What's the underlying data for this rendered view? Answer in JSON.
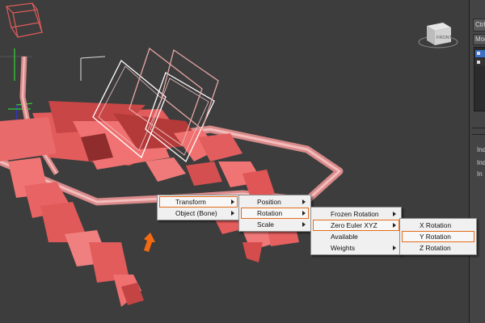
{
  "viewcube": {
    "label": "FRONT"
  },
  "command_panel": {
    "tab_label": "Ctrl",
    "modifier_label": "Mod",
    "rollout_items": [
      "Ind",
      "Ind",
      "In"
    ]
  },
  "menus": {
    "level1": [
      {
        "label": "Transform",
        "has_submenu": true,
        "highlighted": true
      },
      {
        "label": "Object (Bone)",
        "has_submenu": true,
        "highlighted": false
      }
    ],
    "level2": [
      {
        "label": "Position",
        "has_submenu": true,
        "highlighted": false
      },
      {
        "label": "Rotation",
        "has_submenu": true,
        "highlighted": true
      },
      {
        "label": "Scale",
        "has_submenu": true,
        "highlighted": false
      }
    ],
    "level3": [
      {
        "label": "Frozen Rotation",
        "has_submenu": true,
        "highlighted": false
      },
      {
        "label": "Zero Euler XYZ",
        "has_submenu": true,
        "highlighted": true
      },
      {
        "label": "Available",
        "has_submenu": false,
        "highlighted": false
      },
      {
        "label": "Weights",
        "has_submenu": true,
        "highlighted": false
      }
    ],
    "level4": [
      {
        "label": "X Rotation",
        "has_submenu": false,
        "highlighted": false
      },
      {
        "label": "Y Rotation",
        "has_submenu": false,
        "highlighted": true
      },
      {
        "label": "Z Rotation",
        "has_submenu": false,
        "highlighted": false
      }
    ]
  },
  "colors": {
    "viewport_bg": "#3d3d3d",
    "bone_fill": "#f06a6a",
    "bone_dark": "#b93e3e",
    "bone_wire": "#e88d8d",
    "selected_wire": "#ffffff",
    "highlight_outline": "#e46c1a",
    "arrow": "#f36a10"
  }
}
